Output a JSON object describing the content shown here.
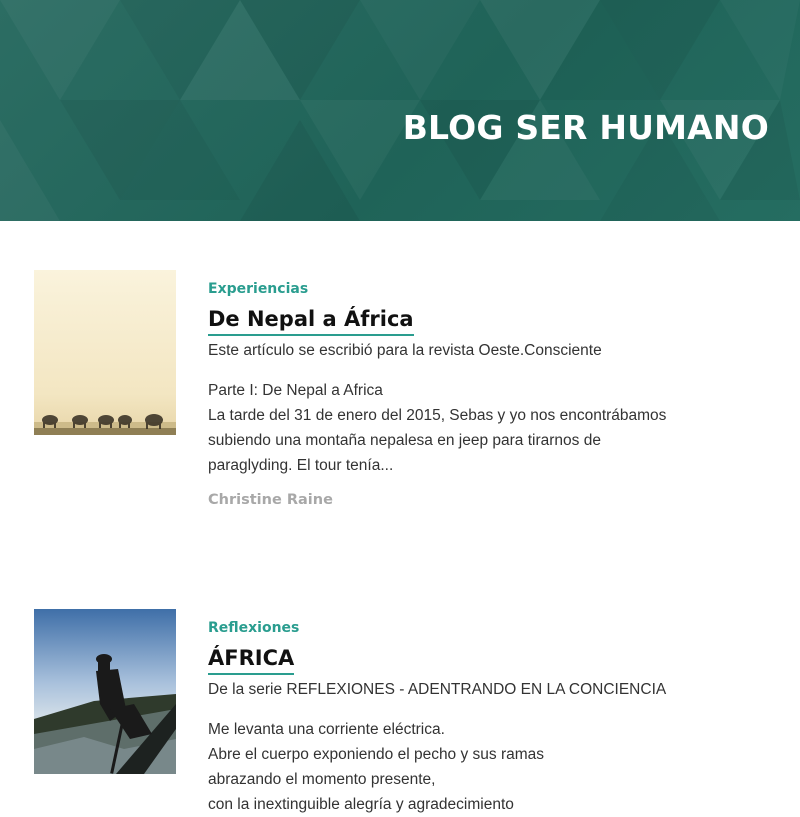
{
  "header": {
    "title": "BLOG SER HUMANO",
    "background_color": "#256b60"
  },
  "accent_color": "#2a9d8f",
  "posts": [
    {
      "category": "Experiencias",
      "title": "De Nepal a África",
      "subtitle": "Este artículo se escribió para la revista Oeste.Consciente",
      "excerpt_lines": [
        "Parte I: De Nepal a Africa",
        "La tarde del 31 de enero del 2015, Sebas y yo nos encontrábamos",
        "subiendo una montaña nepalesa en jeep para tirarnos de",
        "paraglyding. El tour tenía..."
      ],
      "author": "Christine Raine",
      "image": "elephants-at-dusk-image"
    },
    {
      "category": "Reflexiones",
      "title": "ÁFRICA",
      "subtitle": "De la serie REFLEXIONES - ADENTRANDO EN LA CONCIENCIA",
      "excerpt_lines": [
        "Me levanta una corriente eléctrica.",
        "Abre el cuerpo exponiendo el pecho y sus ramas",
        "abrazando el momento presente,",
        "con la inextinguible alegría y agradecimiento"
      ],
      "image": "canoe-river-image"
    }
  ]
}
